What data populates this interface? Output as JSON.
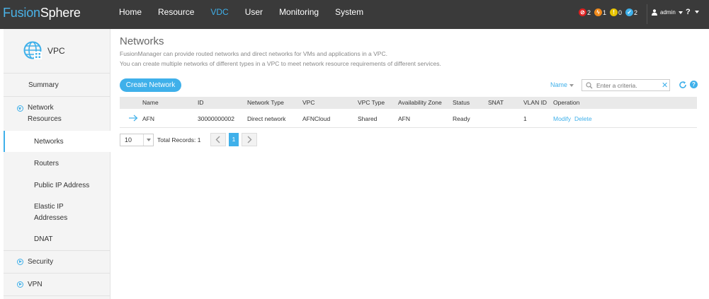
{
  "app": {
    "logo_part1": "Fusion",
    "logo_part2": "Sphere"
  },
  "nav": {
    "items": [
      "Home",
      "Resource",
      "VDC",
      "User",
      "Monitoring",
      "System"
    ],
    "active": "VDC"
  },
  "alarms": [
    {
      "icon": "critical-alarm-icon",
      "count": "2",
      "color": "#e02020"
    },
    {
      "icon": "major-alarm-icon",
      "count": "1",
      "color": "#f08a1c"
    },
    {
      "icon": "minor-alarm-icon",
      "count": "0",
      "color": "#e8c400"
    },
    {
      "icon": "warning-alarm-icon",
      "count": "2",
      "color": "#3fb0ea"
    }
  ],
  "user": {
    "name": "admin",
    "help": "?"
  },
  "sidebar": {
    "title": "VPC",
    "items": [
      {
        "label": "Summary"
      },
      {
        "label": "Network Resources",
        "line1": "Network",
        "line2": "Resources",
        "expanded": true
      },
      {
        "label": "Networks",
        "active": true
      },
      {
        "label": "Routers"
      },
      {
        "label": "Public IP Address"
      },
      {
        "label": "Elastic IP Addresses",
        "line1": "Elastic IP",
        "line2": "Addresses"
      },
      {
        "label": "DNAT"
      },
      {
        "label": "Security"
      },
      {
        "label": "VPN"
      }
    ]
  },
  "main": {
    "title": "Networks",
    "desc_line1": "FusionManager can provide routed networks and direct networks for VMs and applications in a VPC.",
    "desc_line2": "You can create multiple networks of different types in a VPC to meet network resource requirements of different services.",
    "create_button": "Create Network",
    "sort_label": "Name",
    "search_placeholder": "Enter a criteria."
  },
  "table": {
    "columns": [
      "Name",
      "ID",
      "Network Type",
      "VPC",
      "VPC Type",
      "Availability Zone",
      "Status",
      "SNAT",
      "VLAN ID",
      "Operation"
    ],
    "rows": [
      {
        "name": "AFN",
        "id": "30000000002",
        "network_type": "Direct network",
        "vpc": "AFNCloud",
        "vpc_type": "Shared",
        "availability_zone": "AFN",
        "status": "Ready",
        "snat": "",
        "vlan_id": "1",
        "op_modify": "Modify",
        "op_delete": "Delete"
      }
    ]
  },
  "pagination": {
    "page_size": "10",
    "total_records": "Total Records: 1",
    "current_page": "1"
  },
  "colors": {
    "accent": "#3fb0ea",
    "topbar": "#3a3a3a",
    "sidebar_bg": "#f4f4f4"
  }
}
